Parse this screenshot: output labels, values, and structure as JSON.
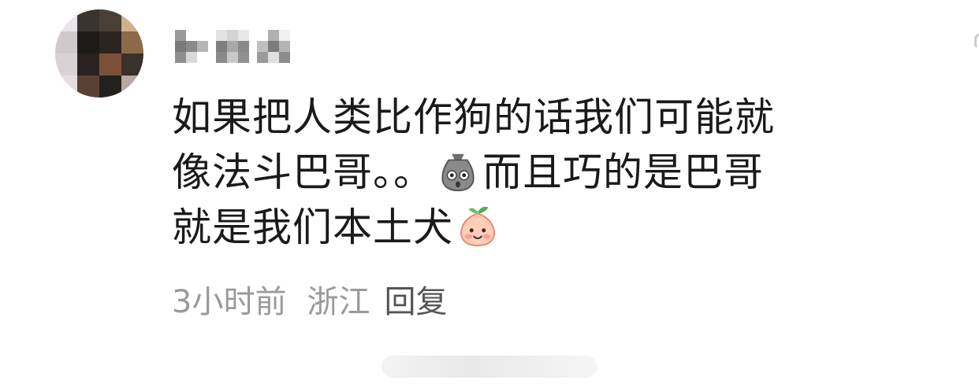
{
  "comment": {
    "avatar_icon": "pixelated-avatar",
    "username_icon": "pixelated-username",
    "text_lines": [
      "如果把人类比作狗的话我们可能就",
      "像法斗巴哥。。",
      "而且巧的是巴哥",
      "就是我们本土犬"
    ],
    "emojis": [
      "surprised-bag-emoji",
      "smiling-peach-emoji"
    ],
    "meta": {
      "time": "3小时前",
      "location": "浙江",
      "reply_label": "回复"
    }
  }
}
